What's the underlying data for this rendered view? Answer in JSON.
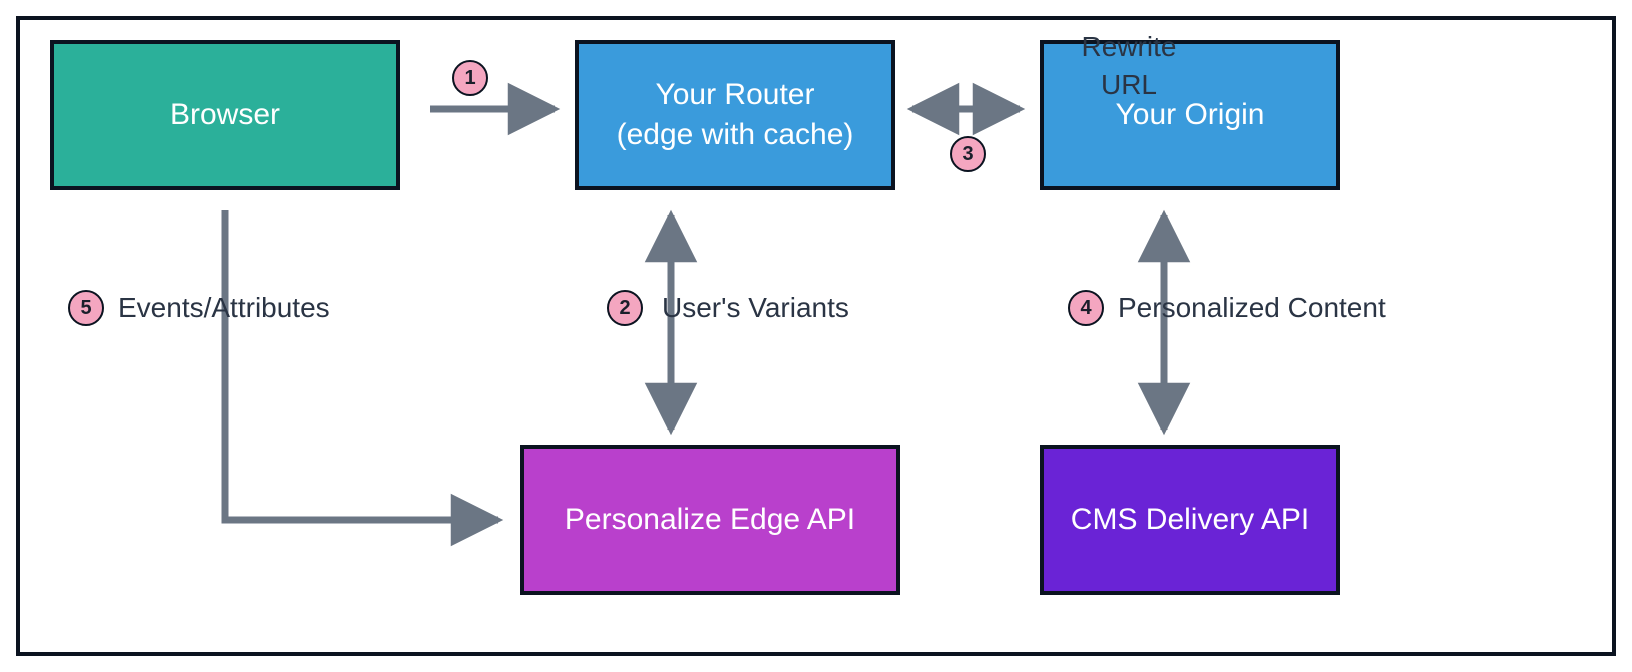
{
  "nodes": {
    "browser": "Browser",
    "router": "Your Router\n(edge with cache)",
    "origin": "Your Origin",
    "edgeapi": "Personalize Edge API",
    "cmsapi": "CMS Delivery API"
  },
  "steps": {
    "s1": {
      "num": "1",
      "label": ""
    },
    "s2": {
      "num": "2",
      "label": "User's Variants"
    },
    "s3": {
      "num": "3",
      "label": "Rewrite\nURL"
    },
    "s4": {
      "num": "4",
      "label": "Personalized Content"
    },
    "s5": {
      "num": "5",
      "label": "Events/Attributes"
    }
  }
}
